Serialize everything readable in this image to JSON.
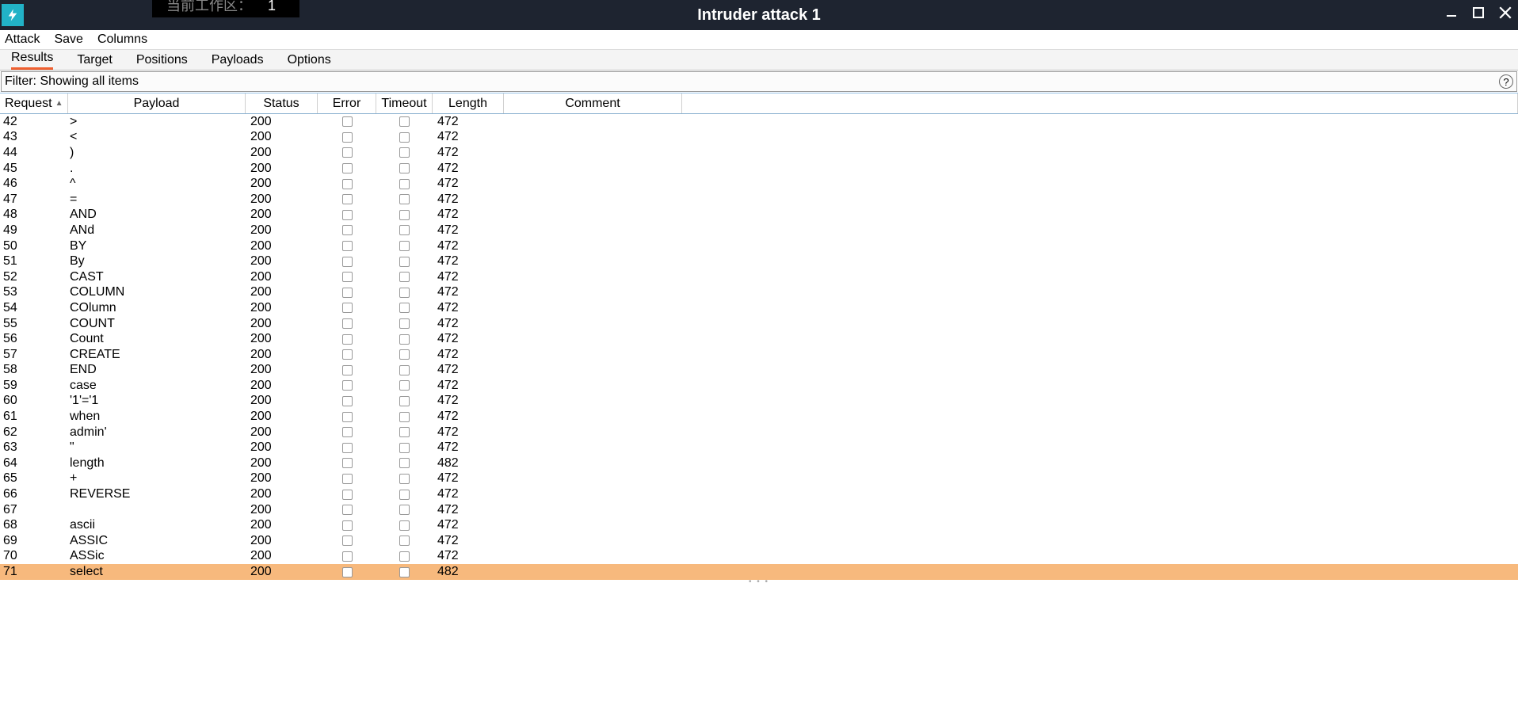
{
  "titlebar": {
    "workspace_label": "当前工作区：",
    "workspace_number": "1",
    "title": "Intruder attack 1"
  },
  "menubar": [
    "Attack",
    "Save",
    "Columns"
  ],
  "tabs": [
    "Results",
    "Target",
    "Positions",
    "Payloads",
    "Options"
  ],
  "active_tab": 0,
  "filter_text": "Filter: Showing all items",
  "columns": [
    "Request",
    "Payload",
    "Status",
    "Error",
    "Timeout",
    "Length",
    "Comment"
  ],
  "sort_column": "Request",
  "sort_dir": "asc",
  "rows": [
    {
      "request": "42",
      "payload": ">",
      "status": "200",
      "error": false,
      "timeout": false,
      "length": "472",
      "comment": "",
      "selected": false
    },
    {
      "request": "43",
      "payload": "<",
      "status": "200",
      "error": false,
      "timeout": false,
      "length": "472",
      "comment": "",
      "selected": false
    },
    {
      "request": "44",
      "payload": ")",
      "status": "200",
      "error": false,
      "timeout": false,
      "length": "472",
      "comment": "",
      "selected": false
    },
    {
      "request": "45",
      "payload": ".",
      "status": "200",
      "error": false,
      "timeout": false,
      "length": "472",
      "comment": "",
      "selected": false
    },
    {
      "request": "46",
      "payload": "^",
      "status": "200",
      "error": false,
      "timeout": false,
      "length": "472",
      "comment": "",
      "selected": false
    },
    {
      "request": "47",
      "payload": "=",
      "status": "200",
      "error": false,
      "timeout": false,
      "length": "472",
      "comment": "",
      "selected": false
    },
    {
      "request": "48",
      "payload": "AND",
      "status": "200",
      "error": false,
      "timeout": false,
      "length": "472",
      "comment": "",
      "selected": false
    },
    {
      "request": "49",
      "payload": "ANd",
      "status": "200",
      "error": false,
      "timeout": false,
      "length": "472",
      "comment": "",
      "selected": false
    },
    {
      "request": "50",
      "payload": "BY",
      "status": "200",
      "error": false,
      "timeout": false,
      "length": "472",
      "comment": "",
      "selected": false
    },
    {
      "request": "51",
      "payload": "By",
      "status": "200",
      "error": false,
      "timeout": false,
      "length": "472",
      "comment": "",
      "selected": false
    },
    {
      "request": "52",
      "payload": "CAST",
      "status": "200",
      "error": false,
      "timeout": false,
      "length": "472",
      "comment": "",
      "selected": false
    },
    {
      "request": "53",
      "payload": "COLUMN",
      "status": "200",
      "error": false,
      "timeout": false,
      "length": "472",
      "comment": "",
      "selected": false
    },
    {
      "request": "54",
      "payload": "COlumn",
      "status": "200",
      "error": false,
      "timeout": false,
      "length": "472",
      "comment": "",
      "selected": false
    },
    {
      "request": "55",
      "payload": "COUNT",
      "status": "200",
      "error": false,
      "timeout": false,
      "length": "472",
      "comment": "",
      "selected": false
    },
    {
      "request": "56",
      "payload": "Count",
      "status": "200",
      "error": false,
      "timeout": false,
      "length": "472",
      "comment": "",
      "selected": false
    },
    {
      "request": "57",
      "payload": "CREATE",
      "status": "200",
      "error": false,
      "timeout": false,
      "length": "472",
      "comment": "",
      "selected": false
    },
    {
      "request": "58",
      "payload": "END",
      "status": "200",
      "error": false,
      "timeout": false,
      "length": "472",
      "comment": "",
      "selected": false
    },
    {
      "request": "59",
      "payload": "case",
      "status": "200",
      "error": false,
      "timeout": false,
      "length": "472",
      "comment": "",
      "selected": false
    },
    {
      "request": "60",
      "payload": "'1'='1",
      "status": "200",
      "error": false,
      "timeout": false,
      "length": "472",
      "comment": "",
      "selected": false
    },
    {
      "request": "61",
      "payload": "when",
      "status": "200",
      "error": false,
      "timeout": false,
      "length": "472",
      "comment": "",
      "selected": false
    },
    {
      "request": "62",
      "payload": "admin'",
      "status": "200",
      "error": false,
      "timeout": false,
      "length": "472",
      "comment": "",
      "selected": false
    },
    {
      "request": "63",
      "payload": "\"",
      "status": "200",
      "error": false,
      "timeout": false,
      "length": "472",
      "comment": "",
      "selected": false
    },
    {
      "request": "64",
      "payload": "length",
      "status": "200",
      "error": false,
      "timeout": false,
      "length": "482",
      "comment": "",
      "selected": false
    },
    {
      "request": "65",
      "payload": "+",
      "status": "200",
      "error": false,
      "timeout": false,
      "length": "472",
      "comment": "",
      "selected": false
    },
    {
      "request": "66",
      "payload": "REVERSE",
      "status": "200",
      "error": false,
      "timeout": false,
      "length": "472",
      "comment": "",
      "selected": false
    },
    {
      "request": "67",
      "payload": "",
      "status": "200",
      "error": false,
      "timeout": false,
      "length": "472",
      "comment": "",
      "selected": false
    },
    {
      "request": "68",
      "payload": "ascii",
      "status": "200",
      "error": false,
      "timeout": false,
      "length": "472",
      "comment": "",
      "selected": false
    },
    {
      "request": "69",
      "payload": "ASSIC",
      "status": "200",
      "error": false,
      "timeout": false,
      "length": "472",
      "comment": "",
      "selected": false
    },
    {
      "request": "70",
      "payload": "ASSic",
      "status": "200",
      "error": false,
      "timeout": false,
      "length": "472",
      "comment": "",
      "selected": false
    },
    {
      "request": "71",
      "payload": "select",
      "status": "200",
      "error": false,
      "timeout": false,
      "length": "482",
      "comment": "",
      "selected": true
    }
  ]
}
